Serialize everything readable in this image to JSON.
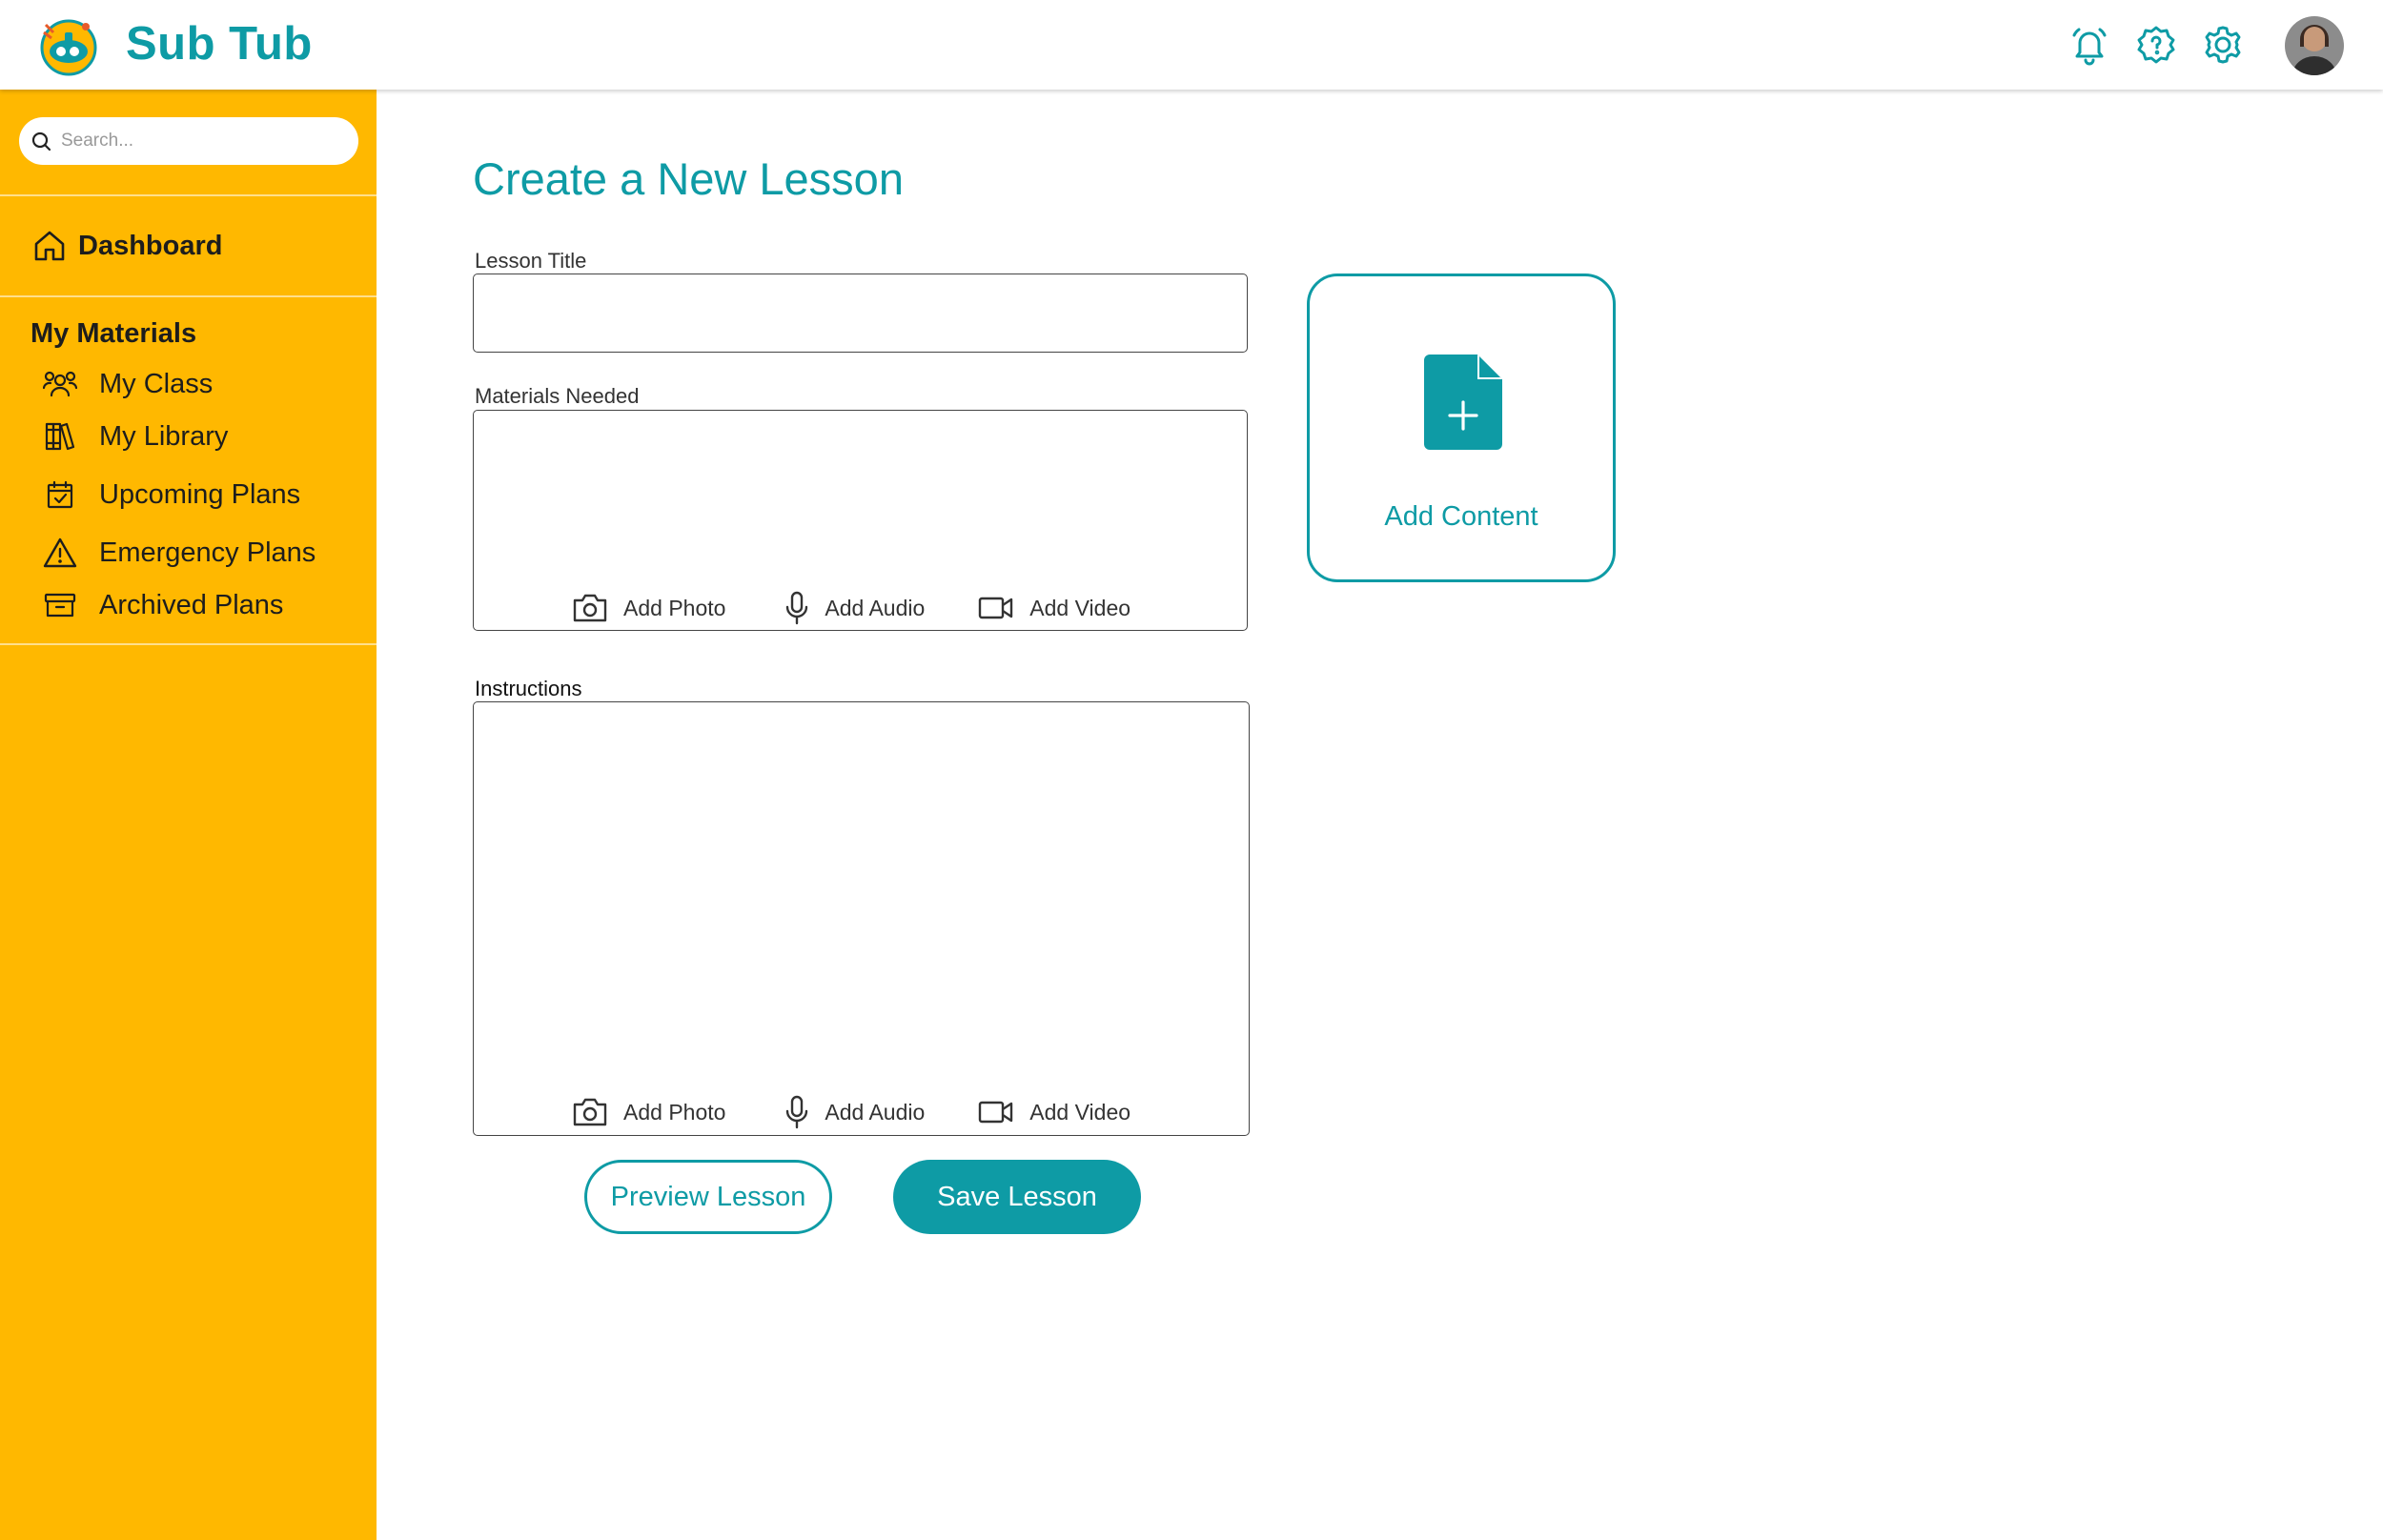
{
  "app": {
    "name": "Sub Tub"
  },
  "colors": {
    "accent": "#0e9ba5",
    "sidebar": "#ffb800"
  },
  "header": {
    "icons": [
      "bell-icon",
      "help-icon",
      "settings-icon"
    ],
    "avatar": "user-avatar"
  },
  "sidebar": {
    "search_placeholder": "Search...",
    "dashboard_label": "Dashboard",
    "section_title": "My Materials",
    "items": [
      {
        "label": "My Class",
        "icon": "users-icon"
      },
      {
        "label": "My Library",
        "icon": "library-icon"
      },
      {
        "label": "Upcoming Plans",
        "icon": "calendar-check-icon"
      },
      {
        "label": "Emergency Plans",
        "icon": "warning-icon"
      },
      {
        "label": "Archived Plans",
        "icon": "archive-icon"
      }
    ]
  },
  "main": {
    "title": "Create a New Lesson",
    "lesson_title_label": "Lesson Title",
    "lesson_title_value": "",
    "materials_label": "Materials Needed",
    "instructions_label": "Instructions",
    "media_tools": {
      "photo": "Add Photo",
      "audio": "Add Audio",
      "video": "Add Video"
    },
    "add_content_label": "Add Content",
    "preview_label": "Preview Lesson",
    "save_label": "Save Lesson"
  }
}
